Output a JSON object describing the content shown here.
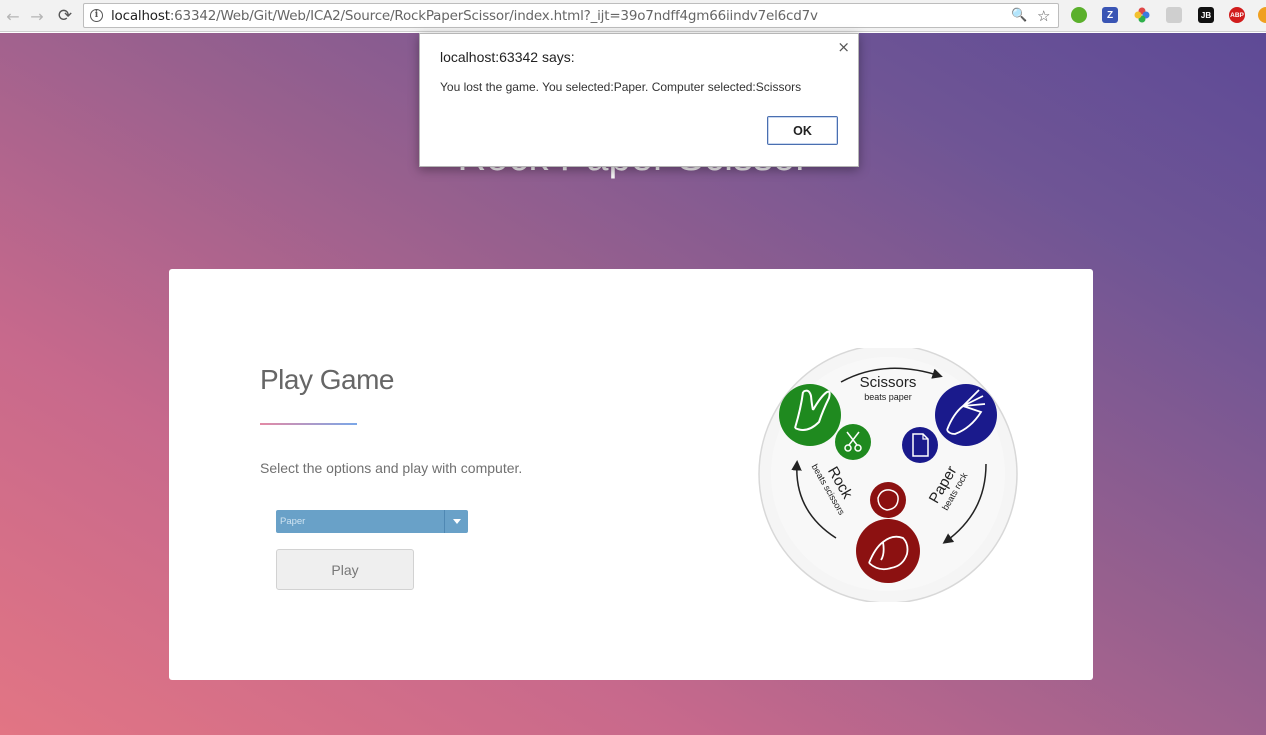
{
  "browser": {
    "back_glyph": "←",
    "forward_glyph": "→",
    "reload_glyph": "⟳",
    "url_host": "localhost",
    "url_rest": ":63342/Web/Git/Web/ICA2/Source/RockPaperScissor/index.html?_ijt=39o7ndff4gm66iindv7el6cd7v",
    "zoom_glyph": "🔍",
    "star_glyph": "☆",
    "extensions": [
      {
        "name": "green-globe-extension-icon",
        "color": "#5bb02c",
        "label": ""
      },
      {
        "name": "zotero-extension-icon",
        "color": "#3a55b4",
        "label": "Z"
      },
      {
        "name": "pinwheel-extension-icon",
        "color": "#e04848",
        "label": ""
      },
      {
        "name": "puzzle-extension-icon",
        "color": "#c8c8c8",
        "label": ""
      },
      {
        "name": "jetbrains-extension-icon",
        "color": "#111111",
        "label": "JB"
      },
      {
        "name": "adblock-plus-extension-icon",
        "color": "#d11c1c",
        "label": "ABP"
      }
    ]
  },
  "page": {
    "hero_title": "Rock Paper Scissor",
    "heading": "Play Game",
    "description": "Select the options and play with computer.",
    "select_value": "Paper",
    "play_label": "Play"
  },
  "diagram": {
    "scissors_label": "Scissors",
    "scissors_sub": "beats paper",
    "rock_label": "Rock",
    "rock_sub": "beats scissors",
    "paper_label": "Paper",
    "paper_sub": "beats rock",
    "colors": {
      "scissors": "#1f8a1f",
      "paper": "#1a1a8c",
      "rock": "#8c1111"
    }
  },
  "dialog": {
    "title": "localhost:63342 says:",
    "message": "You lost the game. You selected:Paper. Computer selected:Scissors",
    "ok_label": "OK",
    "close_glyph": "×"
  }
}
